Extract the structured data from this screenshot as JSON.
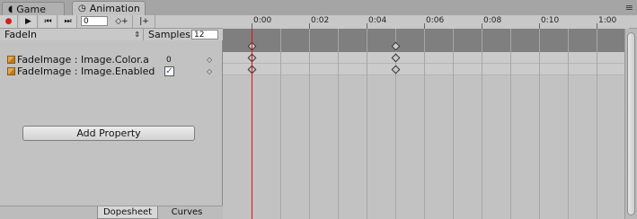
{
  "tabs": [
    {
      "label": "Game",
      "icon": "pacman-icon"
    },
    {
      "label": "Animation",
      "icon": "clock-icon"
    }
  ],
  "toolbar": {
    "record_icon": "●",
    "play_icon": "▶",
    "prev_icon": "⏮",
    "next_icon": "⏭",
    "frame_value": "0",
    "add_key_icon": "◇+",
    "add_event_icon": "|+",
    "record_color": "#d02020"
  },
  "ruler": {
    "labels": [
      "0:00",
      "0:02",
      "0:04",
      "0:06",
      "0:08",
      "0:10",
      "1:00"
    ]
  },
  "clip": {
    "name": "FadeIn",
    "samples_label": "Samples",
    "samples_value": "12"
  },
  "properties": [
    {
      "label": "FadeImage : Image.Color.a",
      "value": "0",
      "type": "float"
    },
    {
      "label": "FadeImage : Image.Enabled",
      "value": "✓",
      "type": "bool"
    }
  ],
  "add_property_label": "Add Property",
  "modes": {
    "dopesheet": "Dopesheet",
    "curves": "Curves"
  },
  "keyframes_at": [
    "0:00",
    "0:04"
  ]
}
